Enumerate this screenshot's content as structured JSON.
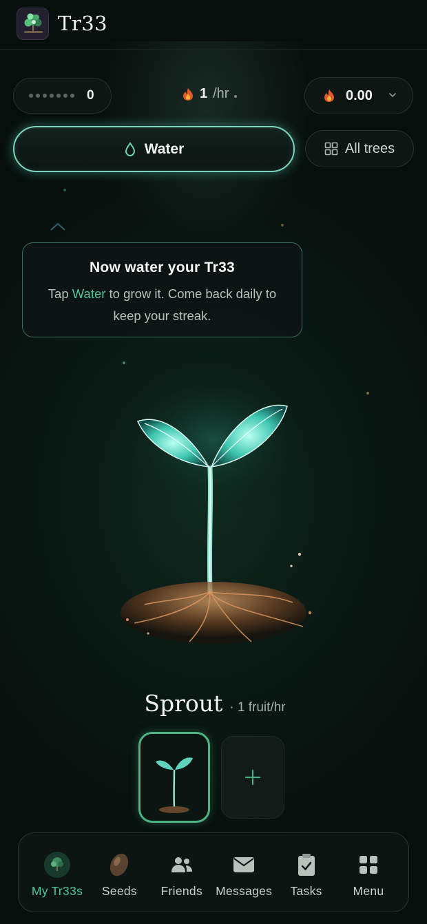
{
  "header": {
    "app_title": "Tr33",
    "logo_icon": "tree-logo-icon"
  },
  "stats": {
    "count_value": "0",
    "rate_value": "1",
    "rate_unit": "/hr",
    "balance_value": "0.00",
    "currency_icon": "flame-icon"
  },
  "actions": {
    "water_label": "Water",
    "all_trees_label": "All trees"
  },
  "tooltip": {
    "title": "Now water your Tr33",
    "body_prefix": "Tap ",
    "body_highlight": "Water",
    "body_suffix": " to grow it. Come back daily to keep your streak."
  },
  "tree": {
    "stage_name": "Sprout",
    "stage_rate": "· 1 fruit/hr"
  },
  "nav": {
    "items": [
      {
        "label": "My Tr33s",
        "icon": "tree-icon",
        "active": true
      },
      {
        "label": "Seeds",
        "icon": "seed-icon",
        "active": false
      },
      {
        "label": "Friends",
        "icon": "friends-icon",
        "active": false
      },
      {
        "label": "Messages",
        "icon": "mail-icon",
        "active": false
      },
      {
        "label": "Tasks",
        "icon": "clipboard-check-icon",
        "active": false
      },
      {
        "label": "Menu",
        "icon": "grid-icon",
        "active": false
      }
    ]
  },
  "colors": {
    "accent": "#4fc39a",
    "water_border": "#7dd4be",
    "background": "#070d0b",
    "flame": "#e0592a"
  }
}
